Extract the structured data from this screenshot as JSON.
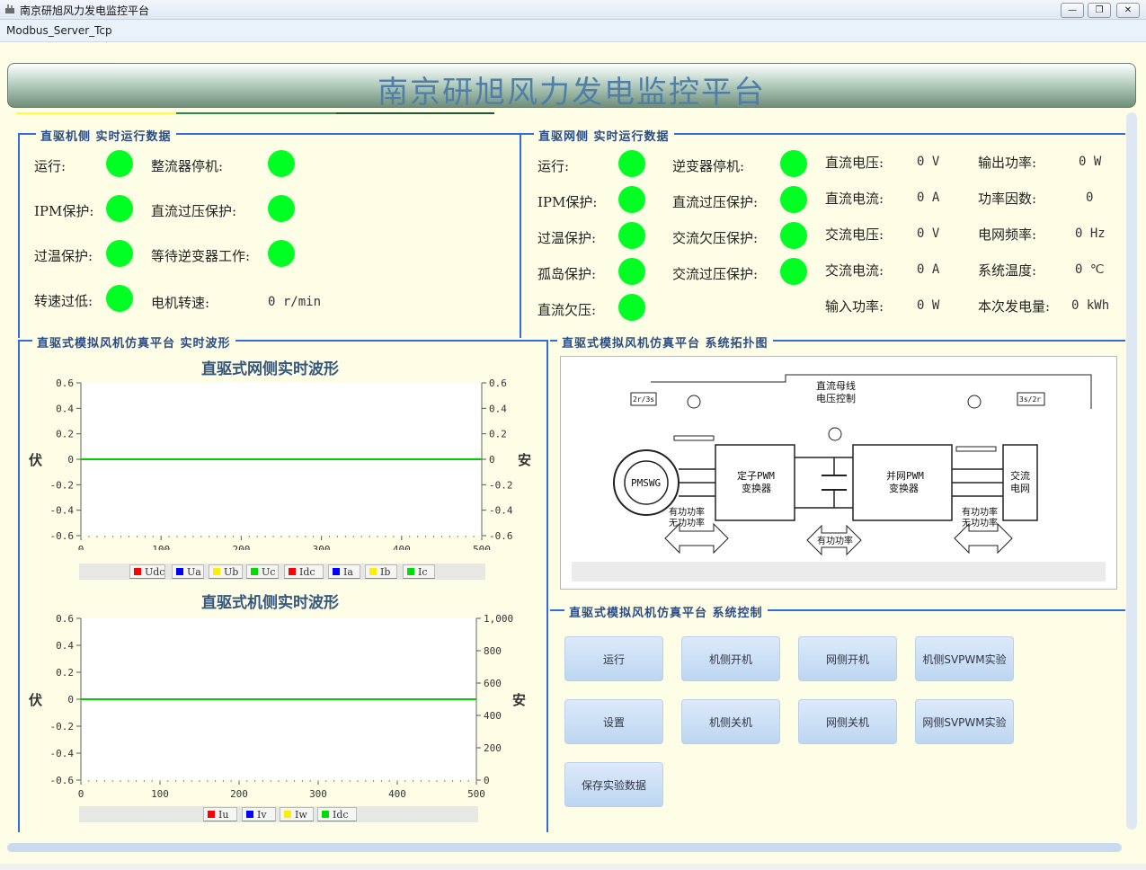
{
  "window": {
    "title": "南京研旭风力发电监控平台",
    "btn_min": "—",
    "btn_max": "❐",
    "btn_close": "✕"
  },
  "menu": {
    "item": "Modbus_Server_Tcp"
  },
  "banner": {
    "title": "南京研旭风力发电监控平台"
  },
  "machine_side": {
    "legend": "直驱机侧 实时运行数据",
    "run": "运行:",
    "rectifier_stop": "整流器停机:",
    "ipm": "IPM保护:",
    "dc_over": "直流过压保护:",
    "over_temp": "过温保护:",
    "wait_inverter": "等待逆变器工作:",
    "over_speed": "转速过低:",
    "speed_label": "电机转速:",
    "speed_value": "0 r/min"
  },
  "grid_side": {
    "legend": "直驱网侧 实时运行数据",
    "run": "运行:",
    "inverter_stop": "逆变器停机:",
    "ipm": "IPM保护:",
    "dc_over": "直流过压保护:",
    "over_temp": "过温保护:",
    "ac_under": "交流欠压保护:",
    "island": "孤岛保护:",
    "ac_over": "交流过压保护:",
    "dc_under": "直流欠压:",
    "dc_voltage": "直流电压:",
    "dc_voltage_v": "0 V",
    "dc_current": "直流电流:",
    "dc_current_v": "0 A",
    "ac_voltage": "交流电压:",
    "ac_voltage_v": "0 V",
    "ac_current": "交流电流:",
    "ac_current_v": "0 A",
    "input_power": "输入功率:",
    "input_power_v": "0 W",
    "output_power": "输出功率:",
    "output_power_v": "0 W",
    "power_factor": "功率因数:",
    "power_factor_v": "0",
    "grid_freq": "电网频率:",
    "grid_freq_v": "0 Hz",
    "sys_temp": "系统温度:",
    "sys_temp_v": "0 ℃",
    "energy": "本次发电量:",
    "energy_v": "0 kWh"
  },
  "wave_group": {
    "legend": "直驱式模拟风机仿真平台 实时波形"
  },
  "topo_group": {
    "legend": "直驱式模拟风机仿真平台 系统拓扑图"
  },
  "control_group": {
    "legend": "直驱式模拟风机仿真平台 系统控制",
    "buttons": [
      "运行",
      "机侧开机",
      "网侧开机",
      "机侧SVPWM实验",
      "设置",
      "机侧关机",
      "网侧关机",
      "网侧SVPWM实验",
      "保存实验数据"
    ]
  },
  "topology": {
    "pmsg": "PMSWG",
    "stator_pwm_1": "定子PWM",
    "stator_pwm_2": "变换器",
    "grid_pwm_1": "并网PWM",
    "grid_pwm_2": "变换器",
    "ac_grid_1": "交流",
    "ac_grid_2": "电网",
    "dc_ctrl_1": "直流母线",
    "dc_ctrl_2": "电压控制",
    "pq_1": "有功功率",
    "pq_2": "无功功率",
    "p_only": "有功功率",
    "t1": "2r/3s",
    "t2": "3s/2r"
  },
  "chart_data": [
    {
      "type": "line",
      "title": "直驱式网侧实时波形",
      "ylabel": "伏",
      "y2label": "安",
      "xlim": [
        0,
        500
      ],
      "ylim": [
        -0.6,
        0.6
      ],
      "y2lim": [
        -0.6,
        0.6
      ],
      "xticks": [
        "0",
        "100",
        "200",
        "300",
        "400",
        "500"
      ],
      "yticks": [
        "0.6",
        "0.4",
        "0.2",
        "0",
        "-0.2",
        "-0.4",
        "-0.6"
      ],
      "y2ticks": [
        "0.6",
        "0.4",
        "0.2",
        "0",
        "-0.2",
        "-0.4",
        "-0.6"
      ],
      "legend": [
        "Udc",
        "Ua",
        "Ub",
        "Uc",
        "Idc",
        "Ia",
        "Ib",
        "Ic"
      ],
      "legend_colors": [
        "#ff0000",
        "#0000ff",
        "#ffee00",
        "#00dd00",
        "#ff0000",
        "#0000ff",
        "#ffee00",
        "#00dd00"
      ],
      "series": [
        {
          "name": "Uc",
          "color": "#00cc00",
          "x": [
            0,
            500
          ],
          "y": [
            0,
            0
          ]
        }
      ]
    },
    {
      "type": "line",
      "title": "直驱式机侧实时波形",
      "ylabel": "伏",
      "y2label": "安",
      "xlim": [
        0,
        500
      ],
      "ylim": [
        -0.6,
        0.6
      ],
      "y2lim": [
        0,
        1000
      ],
      "xticks": [
        "0",
        "100",
        "200",
        "300",
        "400",
        "500"
      ],
      "yticks": [
        "0.6",
        "0.4",
        "0.2",
        "0",
        "-0.2",
        "-0.4",
        "-0.6"
      ],
      "y2ticks": [
        "1,000",
        "800",
        "600",
        "400",
        "200",
        "0"
      ],
      "legend": [
        "Iu",
        "Iv",
        "Iw",
        "Idc"
      ],
      "legend_colors": [
        "#ff0000",
        "#0000ff",
        "#ffee00",
        "#00dd00"
      ],
      "series": [
        {
          "name": "Idc",
          "color": "#00cc00",
          "x": [
            0,
            500
          ],
          "y": [
            0,
            0
          ]
        }
      ]
    }
  ]
}
